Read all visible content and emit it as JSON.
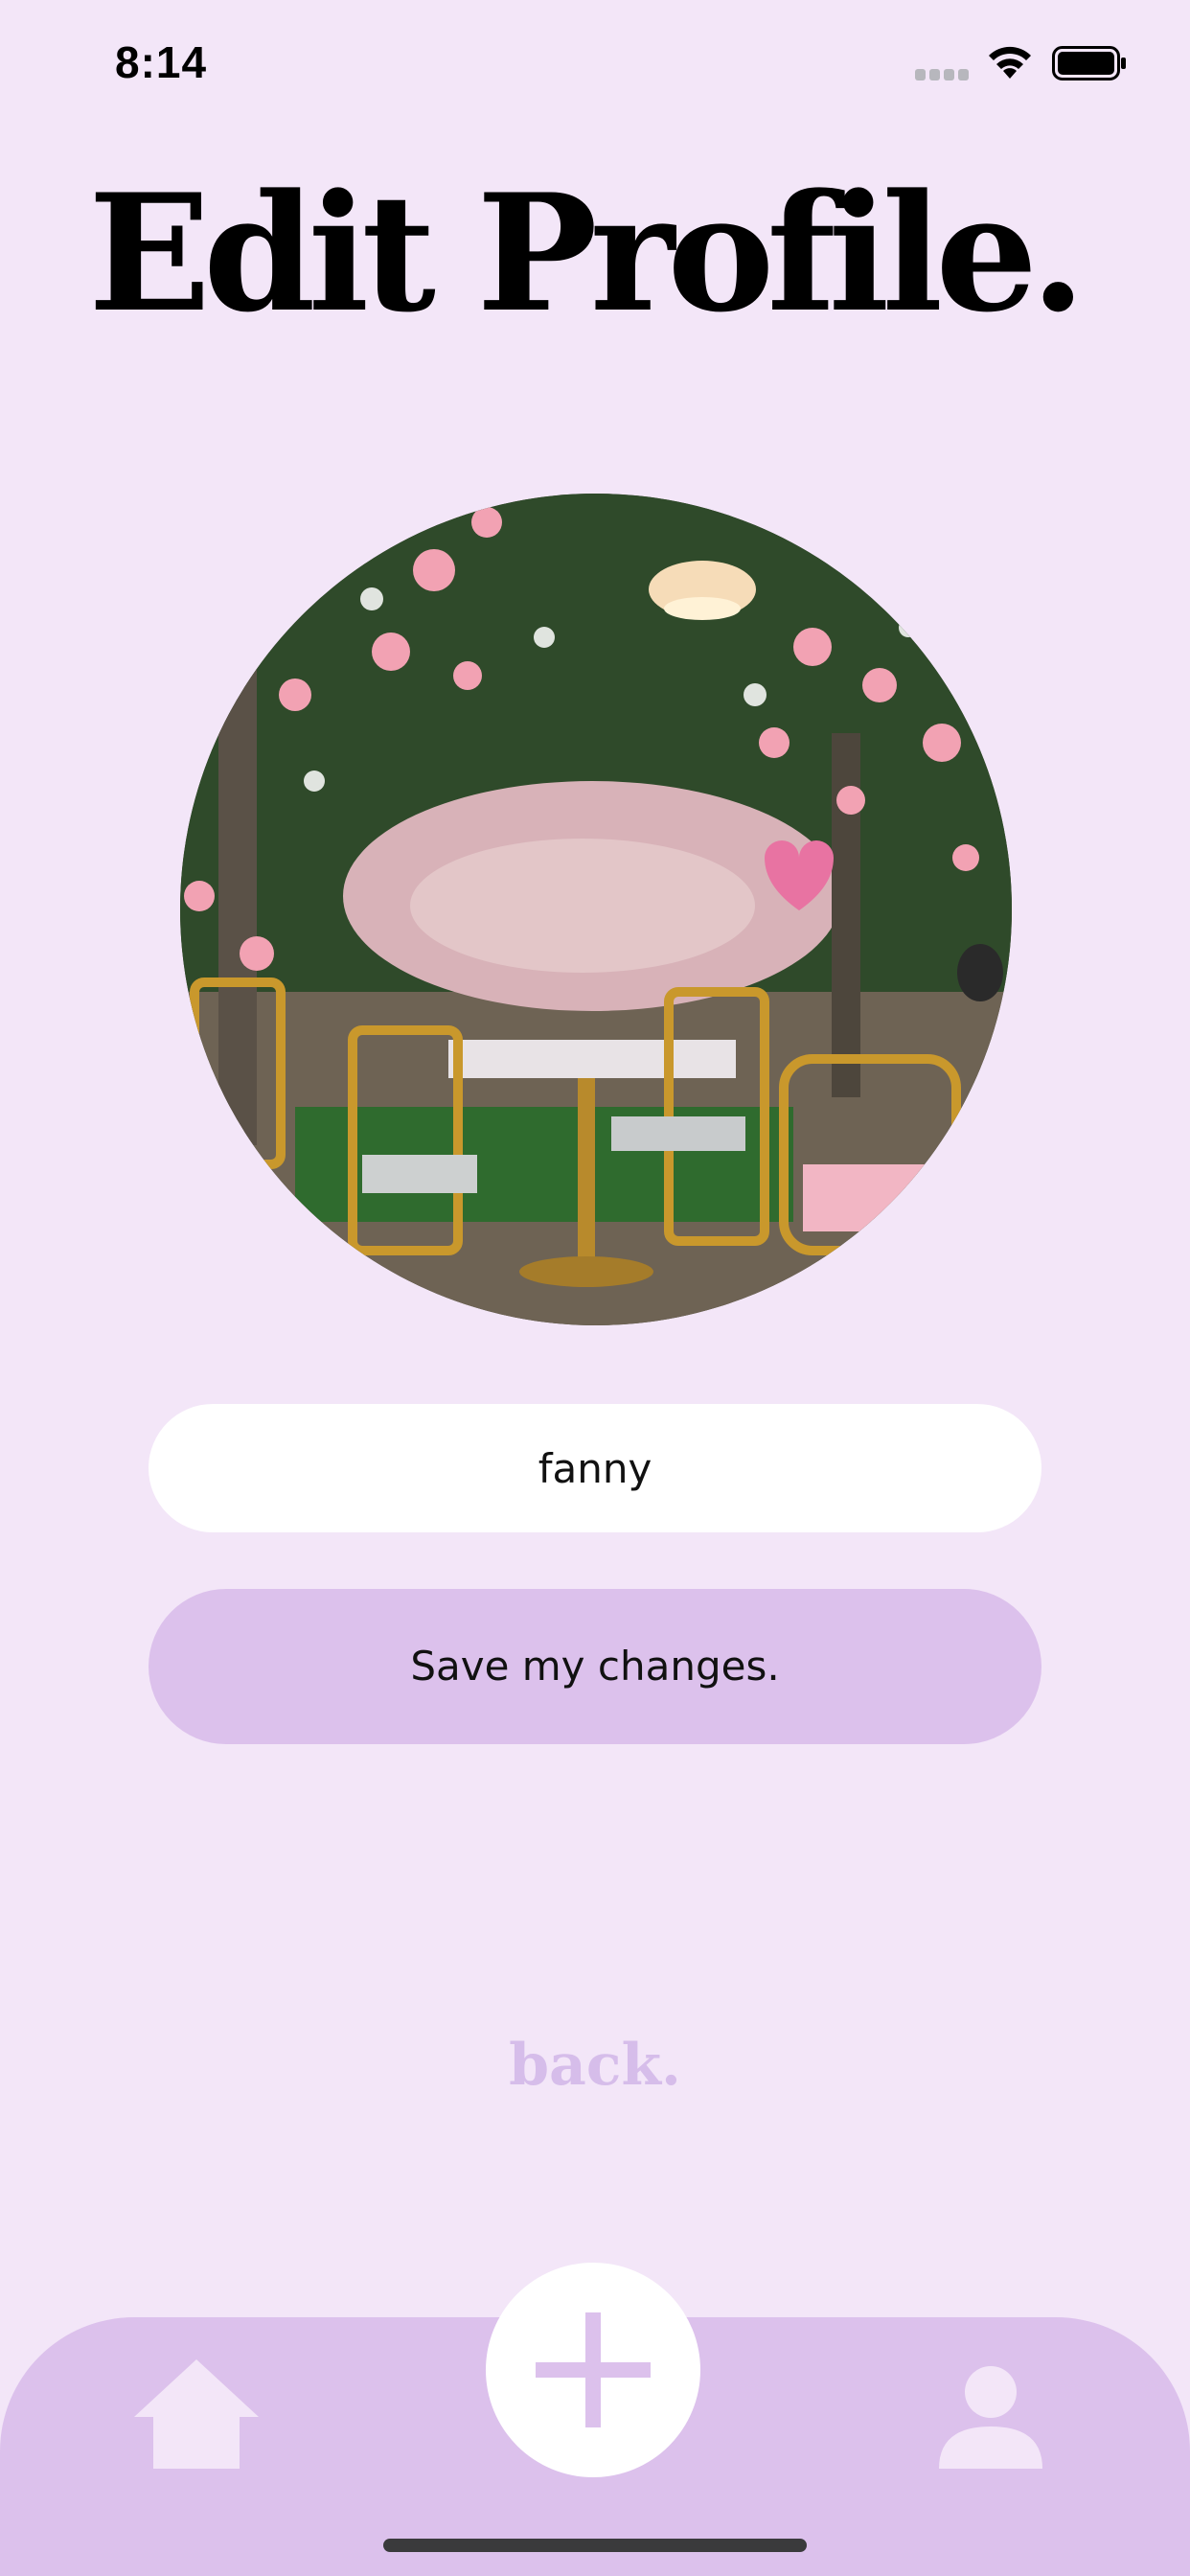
{
  "status_bar": {
    "time": "8:14",
    "icons": [
      "signal-dots-icon",
      "wifi-icon",
      "battery-icon"
    ]
  },
  "page": {
    "title": "Edit Profile."
  },
  "avatar": {
    "description_icon": "profile-photo"
  },
  "name_input": {
    "value": "fanny"
  },
  "save_button": {
    "label": "Save my changes."
  },
  "back_link": {
    "label": "back."
  },
  "tab_bar": {
    "items": [
      {
        "icon": "home-icon"
      },
      {
        "icon": "plus-icon"
      },
      {
        "icon": "person-icon"
      }
    ]
  },
  "colors": {
    "background": "#f3e6f8",
    "accent": "#dcc1ec",
    "back_link": "#d6bdea",
    "input_bg": "#ffffff",
    "tab_icon": "#f3e6f8"
  }
}
